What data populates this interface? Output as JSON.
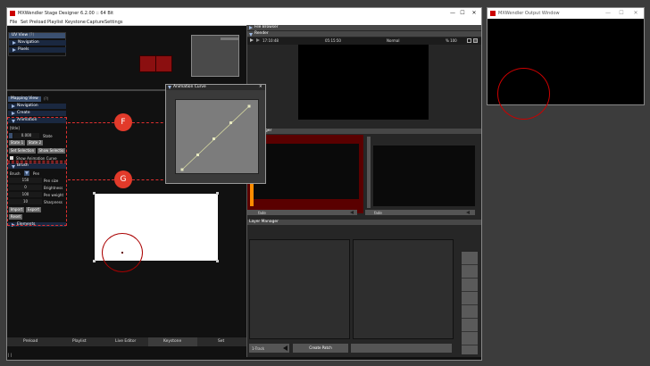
{
  "main_window": {
    "title": "MXWendler Stage Designer 6.2.00  ::  64 Bit",
    "controls": [
      "—",
      "☐",
      "✕"
    ]
  },
  "menu": [
    "File",
    "Set",
    "Preload",
    "Playlist",
    "Keystone",
    "Capture",
    "Settings"
  ],
  "uv_view": {
    "title": "UV View",
    "pct": "(?)",
    "items": [
      "Navigation",
      "Pixels"
    ]
  },
  "mapping_view": {
    "title": "Mapping View",
    "pct": "(?)",
    "items": [
      "Navigation",
      "Create"
    ],
    "animation": {
      "header": "Animation",
      "slot": "[title]",
      "value": "0.000",
      "state_label": "State",
      "state_buttons": [
        "State 1",
        "State 2"
      ],
      "selection_buttons": [
        "Set Selection",
        "Show Selectio"
      ],
      "show_curve": "Show Animation Curve"
    },
    "brush": {
      "header": "Brush",
      "brush_label": "Brush",
      "brush_mode": "Pen",
      "rows": [
        {
          "value": "150",
          "label": "Pen size"
        },
        {
          "value": "0",
          "label": "Brightness"
        },
        {
          "value": "100",
          "label": "Pen weight"
        },
        {
          "value": "10",
          "label": "Sharpness"
        }
      ],
      "buttons": [
        "Import",
        "Export",
        "Reset"
      ],
      "footer": "Elements"
    }
  },
  "markers": [
    "F",
    "G"
  ],
  "bottom_tabs": [
    "Preload",
    "Playlist",
    "Live Editor",
    "Keystone",
    "Set"
  ],
  "status": "| |",
  "animation_curve": {
    "title": "Animation Curve",
    "close": "✕"
  },
  "file_browser": {
    "title": "File Browser"
  },
  "render": {
    "title": "Render",
    "time_left": "17:10:48",
    "time_mid": "05:15:50",
    "mode": "Normal",
    "zoom": "% 100"
  },
  "layer_panel": {
    "title": "Manager",
    "slot_a": "fade",
    "slot_b": "fade"
  },
  "layer_manager": {
    "title": "Layer Manager",
    "track_button": "1-Track",
    "patch_button": "Create Patch"
  },
  "output_window": {
    "title": "MXWendler Output Window",
    "controls": [
      "—",
      "☐",
      "✕"
    ]
  },
  "colors": {
    "accent_red": "#e23a2a",
    "panel_blue": "#1a2840",
    "dark_red": "#5a0000"
  }
}
